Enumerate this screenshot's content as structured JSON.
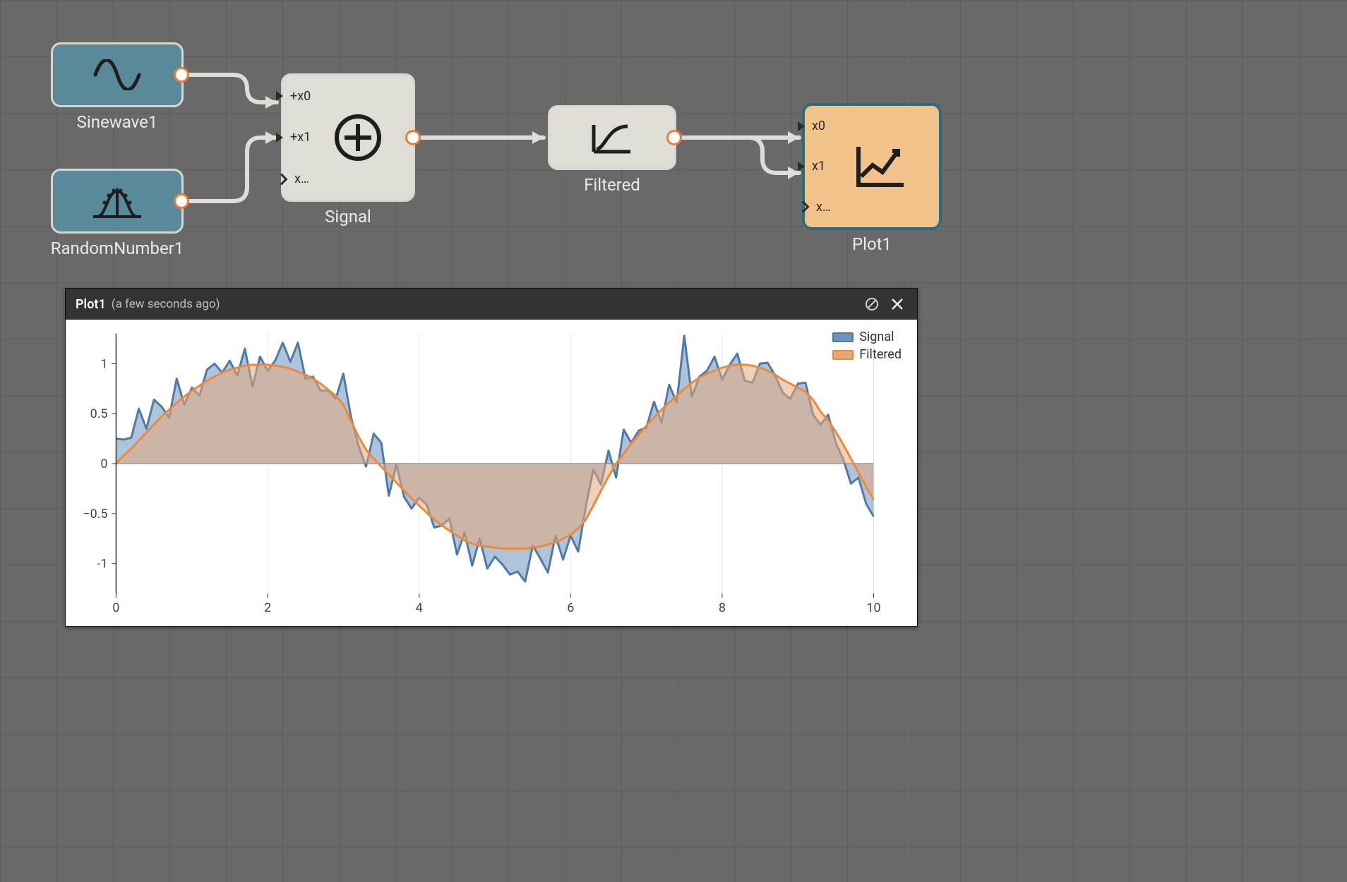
{
  "nodes": {
    "sinewave": {
      "label": "Sinewave1",
      "icon": "sine-icon"
    },
    "random": {
      "label": "RandomNumber1",
      "icon": "random-dist-icon"
    },
    "signal": {
      "label": "Signal",
      "icon": "plus-circle-icon",
      "ports": {
        "p0": "+x0",
        "p1": "+x1",
        "pn": "x…"
      }
    },
    "filtered": {
      "label": "Filtered",
      "icon": "lowpass-icon"
    },
    "plot": {
      "label": "Plot1",
      "icon": "line-chart-icon",
      "ports": {
        "p0": "x0",
        "p1": "x1",
        "pn": "x…"
      }
    }
  },
  "plot_panel": {
    "title": "Plot1",
    "timestamp": "(a few seconds ago)"
  },
  "colors": {
    "signal_stroke": "#4f79a6",
    "signal_fill": "#6e93bd",
    "filtered_stroke": "#ed8a3a",
    "filtered_fill": "#e4a97a"
  },
  "chart_data": {
    "type": "area",
    "xlabel": "",
    "ylabel": "",
    "xlim": [
      0,
      10
    ],
    "ylim": [
      -1.3,
      1.3
    ],
    "x_ticks": [
      0,
      2,
      4,
      6,
      8,
      10
    ],
    "y_ticks": [
      -1,
      -0.5,
      0,
      0.5,
      1
    ],
    "legend_position": "top-right",
    "series": [
      {
        "name": "Signal",
        "x": [
          0.0,
          0.1,
          0.2,
          0.3,
          0.4,
          0.5,
          0.6,
          0.7,
          0.8,
          0.9,
          1.0,
          1.1,
          1.2,
          1.3,
          1.4,
          1.5,
          1.6,
          1.7,
          1.8,
          1.9,
          2.0,
          2.1,
          2.2,
          2.3,
          2.4,
          2.5,
          2.6,
          2.7,
          2.8,
          2.9,
          3.0,
          3.1,
          3.2,
          3.3,
          3.4,
          3.5,
          3.6,
          3.7,
          3.8,
          3.9,
          4.0,
          4.1,
          4.2,
          4.3,
          4.4,
          4.5,
          4.6,
          4.7,
          4.8,
          4.9,
          5.0,
          5.1,
          5.2,
          5.3,
          5.4,
          5.5,
          5.6,
          5.7,
          5.8,
          5.9,
          6.0,
          6.1,
          6.2,
          6.3,
          6.4,
          6.5,
          6.6,
          6.7,
          6.8,
          6.9,
          7.0,
          7.1,
          7.2,
          7.3,
          7.4,
          7.5,
          7.6,
          7.7,
          7.8,
          7.9,
          8.0,
          8.1,
          8.2,
          8.3,
          8.4,
          8.5,
          8.6,
          8.7,
          8.8,
          8.9,
          9.0,
          9.1,
          9.2,
          9.3,
          9.4,
          9.5,
          9.6,
          9.7,
          9.8,
          9.9,
          10.0
        ],
        "values": [
          0.25,
          0.24,
          0.26,
          0.55,
          0.35,
          0.64,
          0.57,
          0.46,
          0.85,
          0.59,
          0.76,
          0.68,
          0.94,
          1.0,
          0.91,
          1.03,
          0.88,
          1.15,
          0.77,
          1.07,
          0.93,
          1.03,
          1.21,
          1.02,
          1.21,
          0.85,
          0.87,
          0.73,
          0.73,
          0.65,
          0.9,
          0.47,
          0.18,
          -0.03,
          0.3,
          0.21,
          -0.32,
          -0.01,
          -0.33,
          -0.45,
          -0.34,
          -0.41,
          -0.64,
          -0.62,
          -0.55,
          -0.91,
          -0.69,
          -1.02,
          -0.75,
          -1.05,
          -0.93,
          -1.01,
          -1.11,
          -1.08,
          -1.18,
          -0.82,
          -0.95,
          -1.09,
          -0.72,
          -0.96,
          -0.72,
          -0.88,
          -0.43,
          -0.06,
          -0.21,
          0.13,
          -0.14,
          0.34,
          0.21,
          0.33,
          0.36,
          0.62,
          0.41,
          0.79,
          0.61,
          1.28,
          0.67,
          0.87,
          0.93,
          1.07,
          0.84,
          0.99,
          1.1,
          0.83,
          0.81,
          1.0,
          1.01,
          0.88,
          0.71,
          0.65,
          0.8,
          0.81,
          0.49,
          0.39,
          0.49,
          0.21,
          0.04,
          -0.2,
          -0.14,
          -0.4,
          -0.53
        ]
      },
      {
        "name": "Filtered",
        "x": [
          0.0,
          0.1,
          0.2,
          0.3,
          0.4,
          0.5,
          0.6,
          0.7,
          0.8,
          0.9,
          1.0,
          1.1,
          1.2,
          1.3,
          1.4,
          1.5,
          1.6,
          1.7,
          1.8,
          1.9,
          2.0,
          2.1,
          2.2,
          2.3,
          2.4,
          2.5,
          2.6,
          2.7,
          2.8,
          2.9,
          3.0,
          3.1,
          3.2,
          3.3,
          3.4,
          3.5,
          3.6,
          3.7,
          3.8,
          3.9,
          4.0,
          4.1,
          4.2,
          4.3,
          4.4,
          4.5,
          4.6,
          4.7,
          4.8,
          4.9,
          5.0,
          5.1,
          5.2,
          5.3,
          5.4,
          5.5,
          5.6,
          5.7,
          5.8,
          5.9,
          6.0,
          6.1,
          6.2,
          6.3,
          6.4,
          6.5,
          6.6,
          6.7,
          6.8,
          6.9,
          7.0,
          7.1,
          7.2,
          7.3,
          7.4,
          7.5,
          7.6,
          7.7,
          7.8,
          7.9,
          8.0,
          8.1,
          8.2,
          8.3,
          8.4,
          8.5,
          8.6,
          8.7,
          8.8,
          8.9,
          9.0,
          9.1,
          9.2,
          9.3,
          9.4,
          9.5,
          9.6,
          9.7,
          9.8,
          9.9,
          10.0
        ],
        "values": [
          0.0,
          0.08,
          0.15,
          0.23,
          0.31,
          0.39,
          0.47,
          0.54,
          0.61,
          0.67,
          0.73,
          0.78,
          0.83,
          0.87,
          0.91,
          0.94,
          0.96,
          0.98,
          0.99,
          0.99,
          0.99,
          0.98,
          0.97,
          0.95,
          0.92,
          0.89,
          0.85,
          0.8,
          0.74,
          0.68,
          0.59,
          0.43,
          0.27,
          0.14,
          0.05,
          -0.03,
          -0.11,
          -0.19,
          -0.27,
          -0.35,
          -0.42,
          -0.49,
          -0.56,
          -0.62,
          -0.67,
          -0.72,
          -0.77,
          -0.8,
          -0.82,
          -0.83,
          -0.84,
          -0.85,
          -0.85,
          -0.85,
          -0.85,
          -0.84,
          -0.83,
          -0.81,
          -0.79,
          -0.75,
          -0.71,
          -0.65,
          -0.56,
          -0.42,
          -0.27,
          -0.13,
          0.0,
          0.1,
          0.2,
          0.29,
          0.38,
          0.46,
          0.54,
          0.61,
          0.68,
          0.75,
          0.81,
          0.86,
          0.9,
          0.93,
          0.96,
          0.98,
          0.99,
          0.99,
          0.98,
          0.96,
          0.93,
          0.89,
          0.84,
          0.8,
          0.76,
          0.72,
          0.64,
          0.52,
          0.43,
          0.32,
          0.19,
          0.05,
          -0.09,
          -0.23,
          -0.36
        ]
      }
    ]
  }
}
